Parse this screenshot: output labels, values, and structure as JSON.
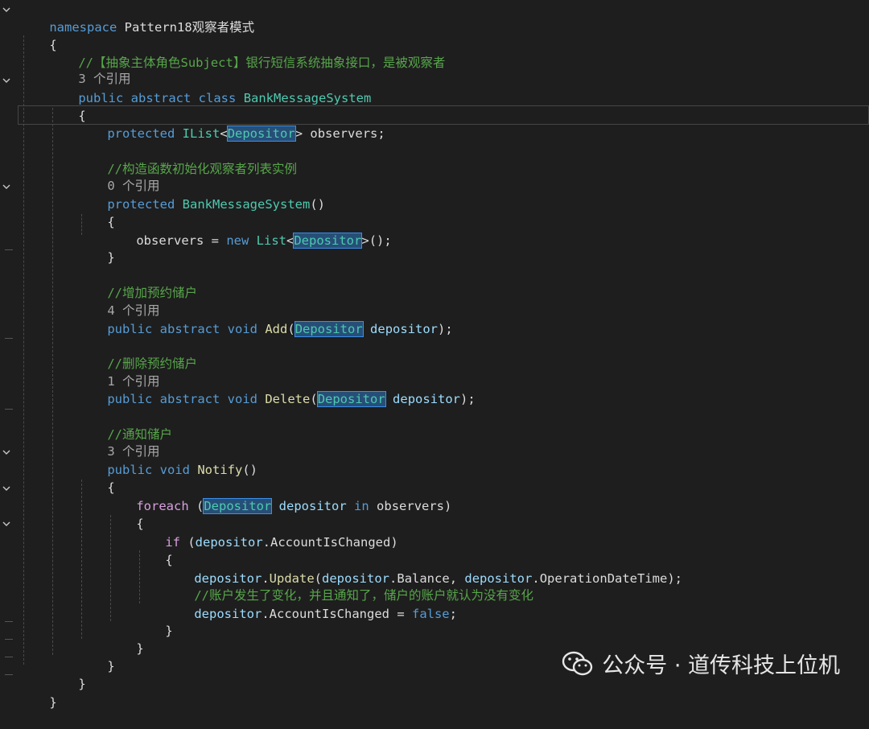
{
  "editor": {
    "lines": {
      "ns_kw": "namespace",
      "ns_name": "Pattern18观察者模式",
      "brace_ns_open": "{",
      "cm_subject": "//【抽象主体角色Subject】银行短信系统抽象接口，是被观察者",
      "refs_class": "3 个引用",
      "class_public": "public",
      "class_abstract": "abstract",
      "class_kw": "class",
      "class_name": "BankMessageSystem",
      "brace_class_open": "{",
      "f_protected": "protected",
      "f_ilist": "IList",
      "f_lt": "<",
      "f_dep": "Depositor",
      "f_gt": ">",
      "f_observers": "observers",
      "f_semi": ";",
      "cm_ctor": "//构造函数初始化观察者列表实例",
      "refs_ctor": "0 个引用",
      "ctor_protected": "protected",
      "ctor_name": "BankMessageSystem",
      "ctor_parens": "()",
      "brace_ctor_open": "{",
      "init_observers": "observers",
      "init_eq": " = ",
      "init_new": "new",
      "init_list": "List",
      "init_lt": "<",
      "init_dep": "Depositor",
      "init_gt": ">",
      "init_end": "();",
      "brace_ctor_close": "}",
      "cm_add": "//增加预约储户",
      "refs_add": "4 个引用",
      "add_public": "public",
      "add_abstract": "abstract",
      "add_void": "void",
      "add_name": "Add",
      "add_open": "(",
      "add_dep": "Depositor",
      "add_param": "depositor",
      "add_close": ");",
      "cm_delete": "//删除预约储户",
      "refs_delete": "1 个引用",
      "del_public": "public",
      "del_abstract": "abstract",
      "del_void": "void",
      "del_name": "Delete",
      "del_open": "(",
      "del_dep": "Depositor",
      "del_param": "depositor",
      "del_close": ");",
      "cm_notify": "//通知储户",
      "refs_notify": "3 个引用",
      "not_public": "public",
      "not_void": "void",
      "not_name": "Notify",
      "not_parens": "()",
      "brace_notify_open": "{",
      "fe_kw": "foreach",
      "fe_open": " (",
      "fe_dep": "Depositor",
      "fe_var": "depositor",
      "fe_in": "in",
      "fe_obs": "observers",
      "fe_close": ")",
      "brace_fe_open": "{",
      "if_kw": "if",
      "if_open": " (",
      "if_dep": "depositor",
      "if_dot": ".",
      "if_prop": "AccountIsChanged",
      "if_close": ")",
      "brace_if_open": "{",
      "up_dep": "depositor",
      "up_dot": ".",
      "up_fn": "Update",
      "up_open": "(",
      "up_dep2": "depositor",
      "up_dot2": ".",
      "up_bal": "Balance",
      "up_comma": ", ",
      "up_dep3": "depositor",
      "up_dot3": ".",
      "up_time": "OperationDateTime",
      "up_close": ");",
      "cm_update": "//账户发生了变化，并且通知了，储户的账户就认为没有变化",
      "set_dep": "depositor",
      "set_dot": ".",
      "set_prop": "AccountIsChanged",
      "set_eq": " = ",
      "set_false": "false",
      "set_semi": ";",
      "brace_if_close": "}",
      "brace_fe_close": "}",
      "brace_notify_close": "}",
      "brace_class_close": "}",
      "brace_ns_close": "}"
    }
  },
  "watermark": {
    "text": "公众号 · 道传科技上位机",
    "icon": "wechat-icon"
  },
  "colors": {
    "background": "#1e1e1e",
    "keyword": "#569cd6",
    "control": "#d8a0df",
    "type": "#4ec9b0",
    "function": "#dcdcaa",
    "variable": "#9cdcfe",
    "comment": "#57a64a",
    "highlight": "#264f78"
  }
}
